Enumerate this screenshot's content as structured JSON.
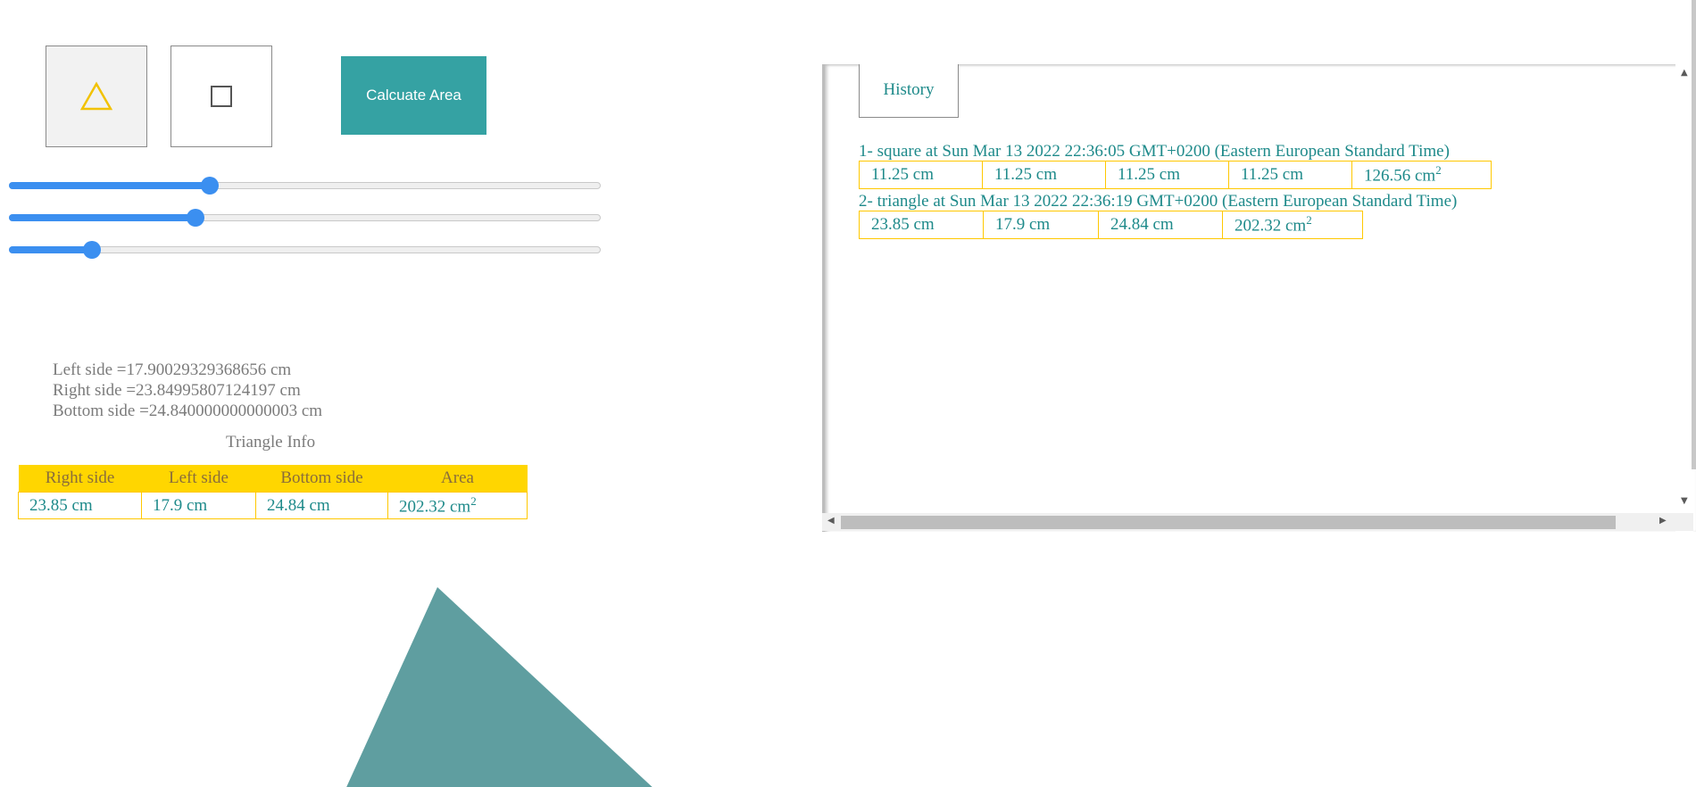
{
  "toolbar": {
    "triangle_icon": "△",
    "square_icon": "□",
    "calculate_label": "Calcuate Area"
  },
  "sliders": [
    {
      "name": "right-side",
      "fraction": 0.34
    },
    {
      "name": "left-side",
      "fraction": 0.315
    },
    {
      "name": "bottom-side",
      "fraction": 0.14
    }
  ],
  "sides": {
    "left": "Left side =17.90029329368656 cm",
    "right": "Right side =23.84995807124197 cm",
    "bottom": "Bottom side =24.840000000000003 cm"
  },
  "info": {
    "title": "Triangle Info",
    "headers": [
      "Right side",
      "Left side",
      "Bottom side",
      "Area"
    ],
    "values": [
      "23.85 cm",
      "17.9 cm",
      "24.84 cm",
      "202.32 cm"
    ],
    "area_unit_exponent": "2"
  },
  "history": {
    "button_label": "History",
    "entries": [
      {
        "title": "1- square at Sun Mar 13 2022 22:36:05 GMT+0200 (Eastern European Standard Time)",
        "values": [
          "11.25 cm",
          "11.25 cm",
          "11.25 cm",
          "11.25 cm",
          "126.56 cm"
        ],
        "exponent": "2"
      },
      {
        "title": "2- triangle at Sun Mar 13 2022 22:36:19 GMT+0200 (Eastern European Standard Time)",
        "values": [
          "23.85 cm",
          "17.9 cm",
          "24.84 cm",
          "202.32 cm"
        ],
        "exponent": "2"
      }
    ]
  },
  "colors": {
    "accent": "#35a2a3",
    "slider": "#3b8ff0",
    "table_header": "#ffd600",
    "text_teal": "#1e8a8a",
    "shape_fill": "#5f9ea0",
    "triangle_icon": "#f2c200"
  }
}
